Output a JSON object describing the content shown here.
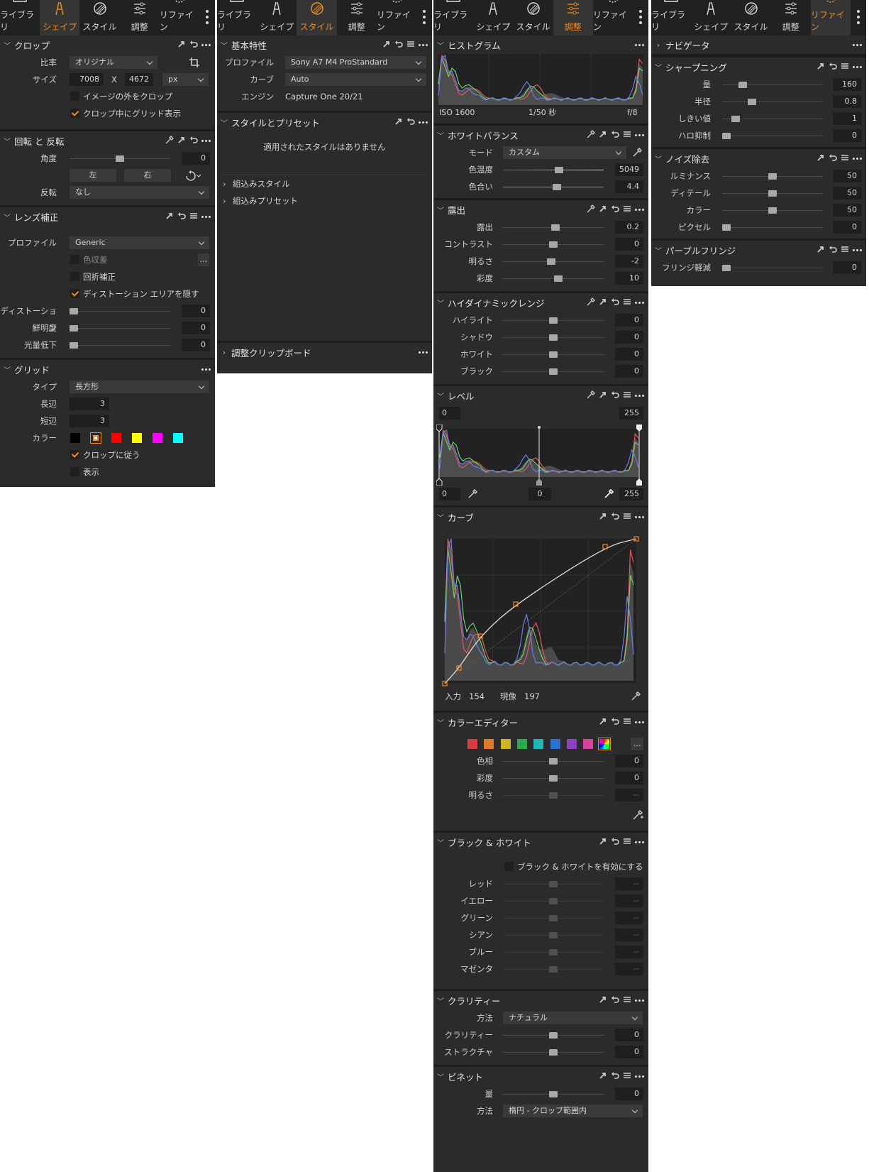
{
  "tabs": [
    {
      "label": "ライブラリ",
      "icon": "folder-icon"
    },
    {
      "label": "シェイプ",
      "icon": "shape-icon"
    },
    {
      "label": "スタイル",
      "icon": "style-icon"
    },
    {
      "label": "調整",
      "icon": "adjust-icon"
    },
    {
      "label": "リファイン",
      "icon": "refine-icon"
    }
  ],
  "shape": {
    "crop": {
      "title": "クロップ",
      "ratio_label": "比率",
      "ratio": "オリジナル",
      "size_label": "サイズ",
      "width": "7008",
      "x": "X",
      "height": "4672",
      "unit": "px",
      "outside_label": "イメージの外をクロップ",
      "outside_checked": false,
      "grid_label": "クロップ中にグリッド表示",
      "grid_checked": true
    },
    "rotate": {
      "title": "回転 と 反転",
      "angle_label": "角度",
      "angle": 0,
      "angle_val": "0",
      "left": "左",
      "right": "右",
      "flip_label": "反転",
      "flip": "なし"
    },
    "lens": {
      "title": "レンズ補正",
      "profile_label": "プロファイル",
      "profile": "Generic",
      "ca_label": "色収差",
      "ca_more": "...",
      "diff_label": "回折補正",
      "hide_label": "ディストーション エリアを隠す",
      "hide_checked": true,
      "sliders": [
        {
          "label": "ディストーション",
          "value": "0",
          "pos": 0
        },
        {
          "label": "鮮明度",
          "value": "0",
          "pos": 0
        },
        {
          "label": "光量低下",
          "value": "0",
          "pos": 0
        }
      ]
    },
    "grid": {
      "title": "グリッド",
      "type_label": "タイプ",
      "type": "長方形",
      "long_label": "長辺",
      "long": "3",
      "short_label": "短辺",
      "short": "3",
      "color_label": "カラー",
      "colors": [
        "#000000",
        "#ffffff",
        "#ff0000",
        "#ffff00",
        "#ff00ff",
        "#00ffff"
      ],
      "follow_label": "クロップに従う",
      "follow_checked": true,
      "show_label": "表示",
      "show_checked": false
    }
  },
  "style": {
    "basic": {
      "title": "基本特性",
      "profile_label": "プロファイル",
      "profile": "Sony A7 M4 ProStandard",
      "curve_label": "カーブ",
      "curve": "Auto",
      "engine_label": "エンジン",
      "engine": "Capture One 20/21"
    },
    "styles": {
      "title": "スタイルとプリセット",
      "empty": "適用されたスタイルはありません",
      "builtin_styles": "組込みスタイル",
      "builtin_presets": "組込みプリセット"
    },
    "clipboard": {
      "title": "調整クリップボード"
    }
  },
  "adjust": {
    "histogram": {
      "title": "ヒストグラム",
      "iso": "ISO 1600",
      "shutter": "1/50 秒",
      "aperture": "f/8"
    },
    "wb": {
      "title": "ホワイトバランス",
      "mode_label": "モード",
      "mode": "カスタム",
      "temp_label": "色温度",
      "temp": "5049",
      "temp_pos": 0.56,
      "tint_label": "色合い",
      "tint": "4.4",
      "tint_pos": 0.54
    },
    "exposure": {
      "title": "露出",
      "sliders": [
        {
          "label": "露出",
          "value": "0.2",
          "pos": 0.52
        },
        {
          "label": "コントラスト",
          "value": "0",
          "pos": 0.5
        },
        {
          "label": "明るさ",
          "value": "-2",
          "pos": 0.48
        },
        {
          "label": "彩度",
          "value": "10",
          "pos": 0.55
        }
      ]
    },
    "hdr": {
      "title": "ハイダイナミックレンジ",
      "sliders": [
        {
          "label": "ハイライト",
          "value": "0",
          "pos": 0.5
        },
        {
          "label": "シャドウ",
          "value": "0",
          "pos": 0.5
        },
        {
          "label": "ホワイト",
          "value": "0",
          "pos": 0.5
        },
        {
          "label": "ブラック",
          "value": "0",
          "pos": 0.5
        }
      ]
    },
    "levels": {
      "title": "レベル",
      "out_low": "0",
      "out_high": "255",
      "in_low": "0",
      "mid": "0",
      "in_high": "255"
    },
    "curve": {
      "title": "カーブ",
      "input_label": "入力",
      "input": "154",
      "output_label": "現像",
      "output": "197"
    },
    "coloreditor": {
      "title": "カラーエディター",
      "swatches": [
        "#d63a43",
        "#e07a2a",
        "#cfb42a",
        "#2aa84a",
        "#1fb7b4",
        "#2f6fd4",
        "#8e3fc4",
        "#d6439a"
      ],
      "more": "...",
      "sliders": [
        {
          "label": "色相",
          "value": "0",
          "pos": 0.5,
          "enabled": true
        },
        {
          "label": "彩度",
          "value": "0",
          "pos": 0.5,
          "enabled": true
        },
        {
          "label": "明るさ",
          "value": "--",
          "pos": 0.5,
          "enabled": false
        }
      ]
    },
    "bw": {
      "title": "ブラック & ホワイト",
      "enable_label": "ブラック & ホワイトを有効にする",
      "enabled": false,
      "sliders": [
        {
          "label": "レッド",
          "value": "--"
        },
        {
          "label": "イエロー",
          "value": "--"
        },
        {
          "label": "グリーン",
          "value": "--"
        },
        {
          "label": "シアン",
          "value": "--"
        },
        {
          "label": "ブルー",
          "value": "--"
        },
        {
          "label": "マゼンタ",
          "value": "--"
        }
      ]
    },
    "clarity": {
      "title": "クラリティー",
      "method_label": "方法",
      "method": "ナチュラル",
      "sliders": [
        {
          "label": "クラリティー",
          "value": "0",
          "pos": 0.5
        },
        {
          "label": "ストラクチャ",
          "value": "0",
          "pos": 0.5
        }
      ]
    },
    "vignette": {
      "title": "ビネット",
      "amount_label": "量",
      "amount": "0",
      "amount_pos": 0.5,
      "method_label": "方法",
      "method": "楕円 - クロップ範囲内"
    }
  },
  "refine": {
    "navigator": {
      "title": "ナビゲータ"
    },
    "sharpen": {
      "title": "シャープニング",
      "sliders": [
        {
          "label": "量",
          "value": "160",
          "pos": 0.18
        },
        {
          "label": "半径",
          "value": "0.8",
          "pos": 0.28
        },
        {
          "label": "しきい値",
          "value": "1",
          "pos": 0.1
        },
        {
          "label": "ハロ抑制",
          "value": "0",
          "pos": 0
        }
      ]
    },
    "noise": {
      "title": "ノイズ除去",
      "sliders": [
        {
          "label": "ルミナンス",
          "value": "50",
          "pos": 0.5
        },
        {
          "label": "ディテール",
          "value": "50",
          "pos": 0.5
        },
        {
          "label": "カラー",
          "value": "50",
          "pos": 0.5
        },
        {
          "label": "ピクセル",
          "value": "0",
          "pos": 0
        }
      ]
    },
    "fringe": {
      "title": "パープルフリンジ",
      "sliders": [
        {
          "label": "フリンジ軽減",
          "value": "0",
          "pos": 0
        }
      ]
    }
  },
  "colors": {
    "accent": "#f08c1e",
    "panel": "#2b2b2b",
    "tabbar": "#212121"
  }
}
